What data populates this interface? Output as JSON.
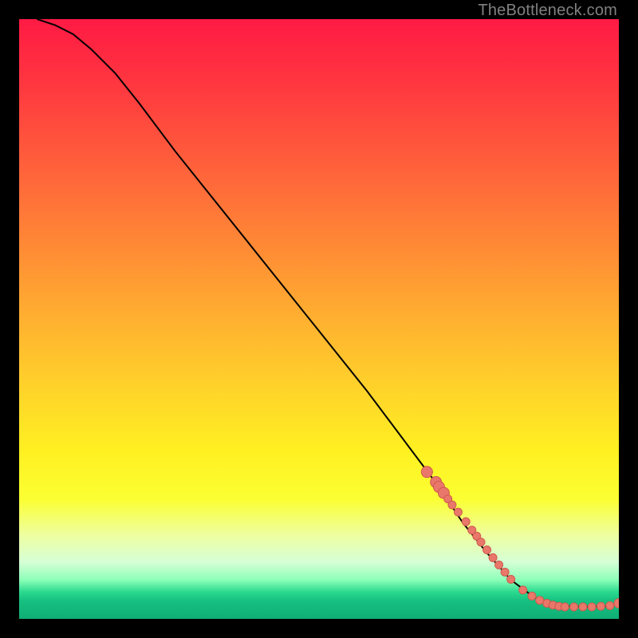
{
  "watermark": "TheBottleneck.com",
  "colors": {
    "bg": "#000000",
    "curve": "#000000",
    "dot_fill": "#e9776a",
    "dot_stroke": "#cf5a4d",
    "gradient_stops": [
      {
        "offset": 0.0,
        "color": "#ff1a44"
      },
      {
        "offset": 0.12,
        "color": "#ff3a3f"
      },
      {
        "offset": 0.25,
        "color": "#ff623b"
      },
      {
        "offset": 0.38,
        "color": "#ff8a35"
      },
      {
        "offset": 0.5,
        "color": "#ffb030"
      },
      {
        "offset": 0.62,
        "color": "#ffd42a"
      },
      {
        "offset": 0.72,
        "color": "#fff021"
      },
      {
        "offset": 0.8,
        "color": "#fbff32"
      },
      {
        "offset": 0.86,
        "color": "#eeffa0"
      },
      {
        "offset": 0.905,
        "color": "#d6ffd6"
      },
      {
        "offset": 0.935,
        "color": "#8cffb8"
      },
      {
        "offset": 0.955,
        "color": "#2bd98f"
      },
      {
        "offset": 0.97,
        "color": "#17c081"
      },
      {
        "offset": 1.0,
        "color": "#0fae75"
      }
    ]
  },
  "chart_data": {
    "type": "line",
    "title": "",
    "xlabel": "",
    "ylabel": "",
    "xlim": [
      0,
      100
    ],
    "ylim": [
      0,
      100
    ],
    "note": "Axes are implicit (no ticks shown). 0–100 normalized to plot area. y=0 at bottom (green), y=100 at top (red).",
    "series": [
      {
        "name": "curve",
        "x": [
          3,
          6,
          9,
          12,
          16,
          20,
          26,
          34,
          42,
          50,
          58,
          64,
          70,
          74,
          78,
          82,
          86,
          90,
          94,
          98,
          100
        ],
        "y": [
          100,
          99,
          97.5,
          95,
          91,
          86,
          78,
          68,
          58,
          48,
          38,
          30,
          22,
          16,
          11,
          6.5,
          3.5,
          2.2,
          2.0,
          2.1,
          2.6
        ]
      }
    ],
    "dots": {
      "name": "highlighted-points",
      "x": [
        68,
        69.5,
        70,
        70.8,
        71.5,
        72.2,
        73.2,
        74.5,
        75.5,
        76.3,
        77,
        78,
        79,
        80,
        81,
        82,
        84,
        85.5,
        86.8,
        88,
        89,
        90,
        91,
        92.5,
        94,
        95.5,
        97,
        98.5,
        100
      ],
      "y": [
        24.5,
        22.8,
        22,
        21,
        20,
        19,
        17.8,
        16.2,
        14.8,
        13.8,
        12.8,
        11.5,
        10.2,
        9,
        7.8,
        6.6,
        4.8,
        3.8,
        3.1,
        2.6,
        2.3,
        2.1,
        2.0,
        2.0,
        2.0,
        2.0,
        2.1,
        2.2,
        2.6
      ],
      "r_first_segment": 7,
      "r_tail": 5,
      "r_end": 6
    }
  }
}
